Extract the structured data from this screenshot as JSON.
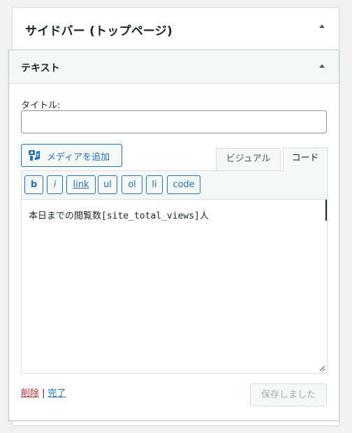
{
  "sidebar": {
    "title": "サイドバー (トップページ)"
  },
  "widget": {
    "title": "テキスト",
    "title_field_label": "タイトル:",
    "title_field_value": "",
    "add_media_label": "メディアを追加",
    "tabs": [
      {
        "label": "ビジュアル",
        "active": false
      },
      {
        "label": "コード",
        "active": true
      }
    ],
    "quicktags": [
      "b",
      "i",
      "link",
      "ul",
      "ol",
      "li",
      "code"
    ],
    "content": "本日までの閲覧数[site_total_views]人",
    "delete_label": "削除",
    "separator": "|",
    "done_label": "完了",
    "save_label": "保存しました"
  },
  "colors": {
    "accent": "#2271b1",
    "delete": "#b32d2e",
    "disabled_text": "#a7aaad",
    "panel_bg": "#f6f7f7"
  },
  "icons": {
    "sidebar_toggle": "caret-up-icon",
    "widget_toggle": "caret-up-icon",
    "media": "media-camera-music-icon",
    "resize": "resize-handle-icon"
  }
}
